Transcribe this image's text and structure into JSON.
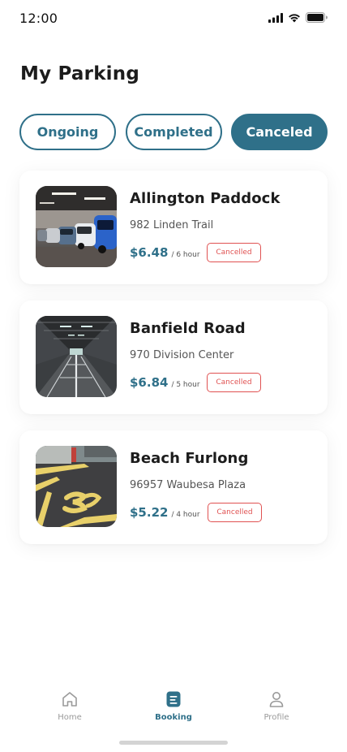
{
  "status_bar": {
    "time": "12:00"
  },
  "page": {
    "title": "My Parking"
  },
  "tabs": [
    {
      "label": "Ongoing",
      "active": false
    },
    {
      "label": "Completed",
      "active": false
    },
    {
      "label": "Canceled",
      "active": true
    }
  ],
  "bookings": [
    {
      "name": "Allington Paddock",
      "address": "982 Linden Trail",
      "price": "$6.48",
      "duration": "/ 6 hour",
      "status": "Cancelled",
      "image_icon": "parking-garage-cars-image"
    },
    {
      "name": "Banfield Road",
      "address": "970 Division Center",
      "price": "$6.84",
      "duration": "/ 5 hour",
      "status": "Cancelled",
      "image_icon": "parking-garage-empty-image"
    },
    {
      "name": "Beach Furlong",
      "address": "96957 Waubesa Plaza",
      "price": "$5.22",
      "duration": "/ 4 hour",
      "status": "Cancelled",
      "image_icon": "parking-lot-marking-image"
    }
  ],
  "bottom_nav": [
    {
      "label": "Home",
      "icon": "home-icon",
      "active": false
    },
    {
      "label": "Booking",
      "icon": "booking-icon",
      "active": true
    },
    {
      "label": "Profile",
      "icon": "profile-icon",
      "active": false
    }
  ],
  "colors": {
    "accent": "#2f7089",
    "cancelled": "#e05252",
    "text": "#1c1c1c",
    "muted": "#9a9a9a"
  }
}
